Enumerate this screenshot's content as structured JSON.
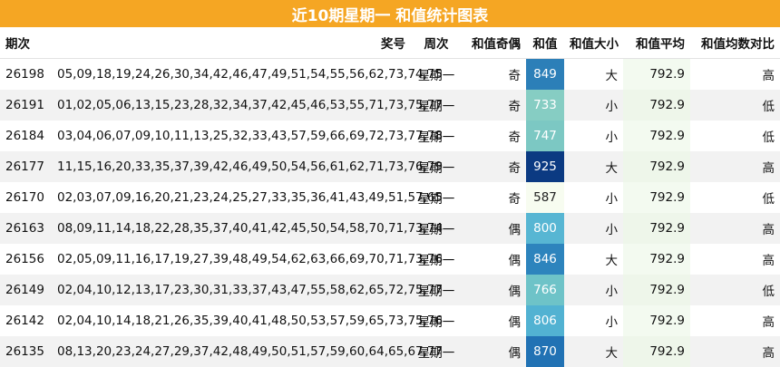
{
  "title": "近10期星期一 和值统计图表",
  "headers": {
    "issue": "期次",
    "numbers": "奖号",
    "weekday": "周次",
    "odd_even": "和值奇偶",
    "sum": "和值",
    "size": "和值大小",
    "avg": "和值平均",
    "compare": "和值均数对比"
  },
  "rows": [
    {
      "issue": "26198",
      "numbers": "05,09,18,19,24,26,30,34,42,46,47,49,51,54,55,56,62,73,74,75",
      "weekday": "星期一",
      "odd_even": "奇",
      "sum": "849",
      "size": "大",
      "avg": "792.9",
      "compare": "高",
      "sum_color": "#2c7fb8"
    },
    {
      "issue": "26191",
      "numbers": "01,02,05,06,13,15,23,28,32,34,37,42,45,46,53,55,71,73,75,77",
      "weekday": "星期一",
      "odd_even": "奇",
      "sum": "733",
      "size": "小",
      "avg": "792.9",
      "compare": "低",
      "sum_color": "#86cdc3"
    },
    {
      "issue": "26184",
      "numbers": "03,04,06,07,09,10,11,13,25,32,33,43,57,59,66,69,72,73,77,78",
      "weekday": "星期一",
      "odd_even": "奇",
      "sum": "747",
      "size": "小",
      "avg": "792.9",
      "compare": "低",
      "sum_color": "#7cc8c3"
    },
    {
      "issue": "26177",
      "numbers": "11,15,16,20,33,35,37,39,42,46,49,50,54,56,61,62,71,73,76,79",
      "weekday": "星期一",
      "odd_even": "奇",
      "sum": "925",
      "size": "大",
      "avg": "792.9",
      "compare": "高",
      "sum_color": "#0b3a82"
    },
    {
      "issue": "26170",
      "numbers": "02,03,07,09,16,20,21,23,24,25,27,33,35,36,41,43,49,51,57,65",
      "weekday": "星期一",
      "odd_even": "奇",
      "sum": "587",
      "size": "小",
      "avg": "792.9",
      "compare": "低",
      "sum_color": "#f7fcf0"
    },
    {
      "issue": "26163",
      "numbers": "08,09,11,14,18,22,28,35,37,40,41,42,45,50,54,58,70,71,73,74",
      "weekday": "星期一",
      "odd_even": "偶",
      "sum": "800",
      "size": "小",
      "avg": "792.9",
      "compare": "高",
      "sum_color": "#57b6d3"
    },
    {
      "issue": "26156",
      "numbers": "02,05,09,11,16,17,19,27,39,48,49,54,62,63,66,69,70,71,73,76",
      "weekday": "星期一",
      "odd_even": "偶",
      "sum": "846",
      "size": "大",
      "avg": "792.9",
      "compare": "高",
      "sum_color": "#2d84bd"
    },
    {
      "issue": "26149",
      "numbers": "02,04,10,12,13,17,23,30,31,33,37,43,47,55,58,62,65,72,75,77",
      "weekday": "星期一",
      "odd_even": "偶",
      "sum": "766",
      "size": "小",
      "avg": "792.9",
      "compare": "低",
      "sum_color": "#6ec3c8"
    },
    {
      "issue": "26142",
      "numbers": "02,04,10,14,18,21,26,35,39,40,41,48,50,53,57,59,65,73,75,76",
      "weekday": "星期一",
      "odd_even": "偶",
      "sum": "806",
      "size": "小",
      "avg": "792.9",
      "compare": "高",
      "sum_color": "#52b2d2"
    },
    {
      "issue": "26135",
      "numbers": "08,13,20,23,24,27,29,37,42,48,49,50,51,57,59,60,64,65,67,77",
      "weekday": "星期一",
      "odd_even": "偶",
      "sum": "870",
      "size": "大",
      "avg": "792.9",
      "compare": "高",
      "sum_color": "#2172b4"
    }
  ]
}
